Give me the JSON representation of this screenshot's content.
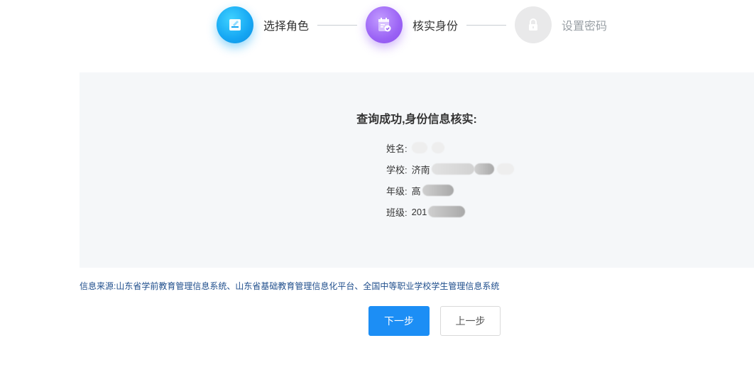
{
  "steps": [
    {
      "label": "选择角色",
      "icon": "edit-doc-icon",
      "state": "done",
      "color": "#15a6f3"
    },
    {
      "label": "核实身份",
      "icon": "calendar-check-icon",
      "state": "active",
      "color": "#9b63f5"
    },
    {
      "label": "设置密码",
      "icon": "lock-icon",
      "state": "pending",
      "color": "#e9e9ea"
    }
  ],
  "result": {
    "title": "查询成功,身份信息核实:",
    "fields": [
      {
        "label": "姓名:",
        "visible_value": ""
      },
      {
        "label": "学校:",
        "visible_value": "济南"
      },
      {
        "label": "年级:",
        "visible_value": "高"
      },
      {
        "label": "班级:",
        "visible_value": "201"
      }
    ]
  },
  "source_note": "信息来源:山东省学前教育管理信息系统、山东省基础教育管理信息化平台、全国中等职业学校学生管理信息系统",
  "buttons": {
    "next_label": "下一步",
    "prev_label": "上一步"
  },
  "colors": {
    "primary": "#1c8ef5",
    "card_bg": "#f5f7f9",
    "source_text": "#1f4e8c"
  }
}
